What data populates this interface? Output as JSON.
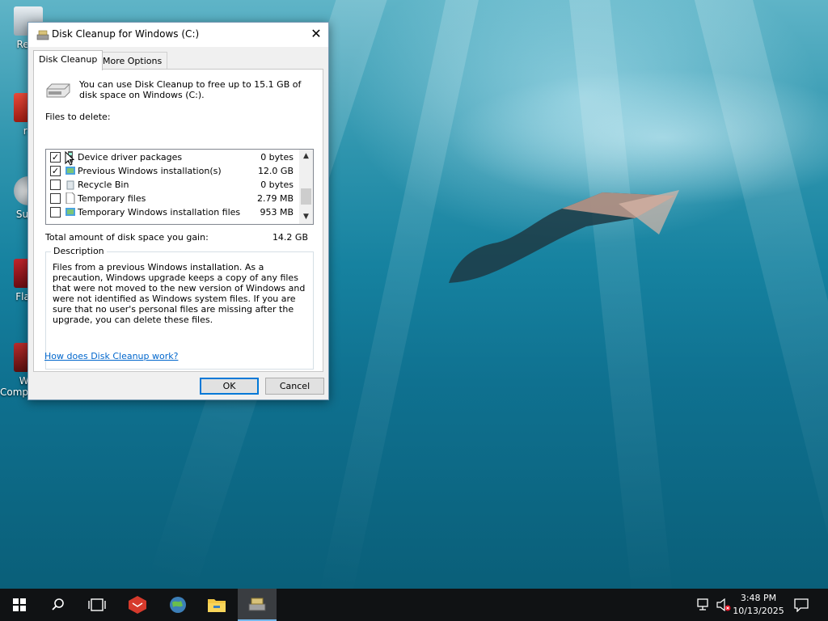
{
  "desktop": {
    "icons": [
      {
        "label": "Recy",
        "name": "recycle-bin"
      },
      {
        "label": "r3",
        "name": "shortcut-r3"
      },
      {
        "label": "Supe",
        "name": "shortcut-super"
      },
      {
        "label": "Flash",
        "name": "shortcut-flash"
      },
      {
        "label": "Win",
        "label2": "Compatibili...",
        "name": "shortcut-compat"
      }
    ]
  },
  "dialog": {
    "title": "Disk Cleanup for Windows (C:)",
    "tabs": [
      "Disk Cleanup",
      "More Options"
    ],
    "intro": "You can use Disk Cleanup to free up to 15.1 GB of disk space on Windows (C:).",
    "files_label": "Files to delete:",
    "files": [
      {
        "name": "Device driver packages",
        "size": "0 bytes",
        "checked": true
      },
      {
        "name": "Previous Windows installation(s)",
        "size": "12.0 GB",
        "checked": true
      },
      {
        "name": "Recycle Bin",
        "size": "0 bytes",
        "checked": false
      },
      {
        "name": "Temporary files",
        "size": "2.79 MB",
        "checked": false
      },
      {
        "name": "Temporary Windows installation files",
        "size": "953 MB",
        "checked": false
      }
    ],
    "total_label": "Total amount of disk space you gain:",
    "total_value": "14.2 GB",
    "description_title": "Description",
    "description": "Files from a previous Windows installation.  As a precaution, Windows upgrade keeps a copy of any files that were not moved to the new version of Windows and were not identified as Windows system files.  If you are sure that no user's personal files are missing after the upgrade, you can delete these files.",
    "help_link": "How does Disk Cleanup work?",
    "ok": "OK",
    "cancel": "Cancel",
    "check_mark": "✓",
    "close_glyph": "✕"
  },
  "taskbar": {
    "time": "3:48 PM",
    "date": "10/13/2025"
  },
  "colors": {
    "accent": "#0078d7",
    "link": "#0066cc",
    "taskbar": "#101214"
  }
}
